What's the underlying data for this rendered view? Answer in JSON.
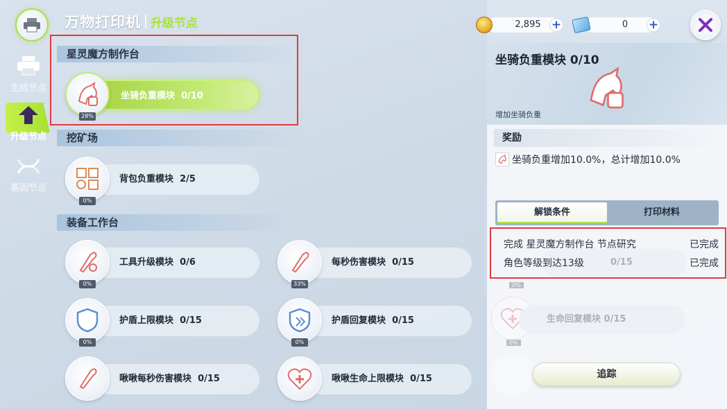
{
  "header": {
    "title": "万物打印机",
    "subtitle": "升级节点"
  },
  "sidebar": {
    "items": [
      {
        "label": "主线节点",
        "icon": "printer-icon",
        "active": false
      },
      {
        "label": "升级节点",
        "icon": "upgrade-arrow-icon",
        "active": true
      },
      {
        "label": "基因节点",
        "icon": "dna-icon",
        "active": false
      }
    ]
  },
  "sections": [
    {
      "title": "星灵魔方制作台"
    },
    {
      "title": "挖矿场"
    },
    {
      "title": "装备工作台"
    }
  ],
  "nodes": {
    "mount_load": {
      "label": "坐骑负重模块",
      "progress": "0/10",
      "pct": "28%",
      "icon": "horse-icon"
    },
    "bag_load": {
      "label": "背包负重模块",
      "progress": "2/5",
      "pct": "0%",
      "icon": "grid-gear-icon"
    },
    "tool_upgrade": {
      "label": "工具升级模块",
      "progress": "0/6",
      "pct": "0%",
      "icon": "bullet-icon"
    },
    "dps": {
      "label": "每秒伤害模块",
      "progress": "0/15",
      "pct": "33%",
      "icon": "bullet-icon"
    },
    "shield_cap": {
      "label": "护盾上限模块",
      "progress": "0/15",
      "pct": "0%",
      "icon": "shield-icon"
    },
    "shield_regen": {
      "label": "护盾回复模块",
      "progress": "0/15",
      "pct": "0%",
      "icon": "shield-regen-icon"
    },
    "pet_dps": {
      "label": "啾啾每秒伤害模块",
      "progress": "0/15",
      "icon": "bullet-icon"
    },
    "pet_hp": {
      "label": "啾啾生命上限模块",
      "progress": "0/15",
      "icon": "heart-plus-icon"
    }
  },
  "currency": [
    {
      "value": "2,895",
      "icon": "gold-coin-icon"
    },
    {
      "value": "0",
      "icon": "blue-ticket-icon"
    }
  ],
  "detail": {
    "title": "坐骑负重模块 0/10",
    "desc": "增加坐骑负重",
    "reward_header": "奖励",
    "reward_text": "坐骑负重增加10.0%，总计增加10.0%",
    "tabs": [
      {
        "label": "解锁条件",
        "active": true
      },
      {
        "label": "打印材料",
        "active": false
      }
    ],
    "conditions": [
      {
        "text": "完成 星灵魔方制作台 节点研究",
        "status": "已完成"
      },
      {
        "text": "角色等级到达13级",
        "status": "已完成"
      }
    ],
    "ghost_nodes": [
      {
        "progress": "0/15",
        "pct": "0%"
      },
      {
        "label": "生命回复模块",
        "progress": "0/15",
        "pct": "0%"
      }
    ],
    "track_button": "追踪"
  },
  "colors": {
    "accent_green": "#a9e23b",
    "highlight_red": "#e23a3a",
    "close_purple": "#7b2fbf"
  }
}
